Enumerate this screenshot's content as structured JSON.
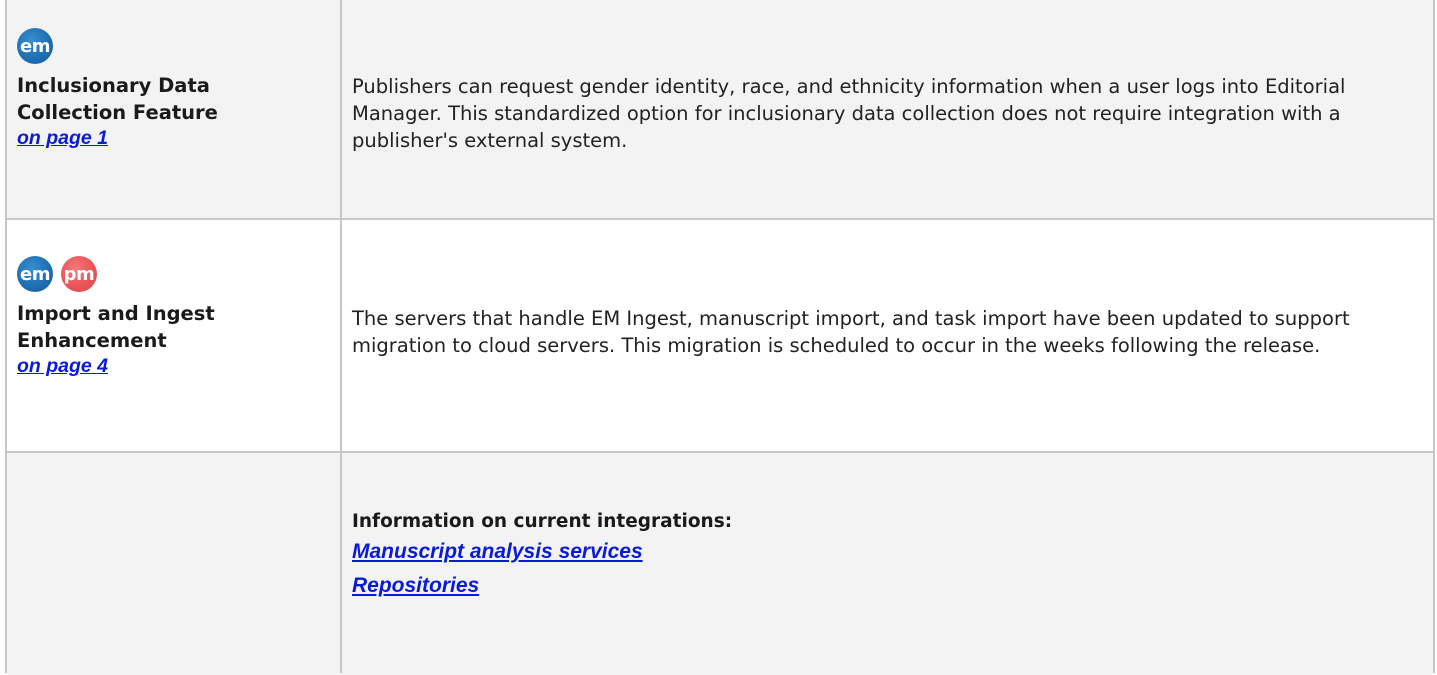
{
  "rows": [
    {
      "badges": [
        "em"
      ],
      "title": "Inclusionary Data Collection Feature",
      "link": "on page 1",
      "description": "Publishers can request gender identity, race, and ethnicity information when a user logs into Editorial Manager. This standardized option for inclusionary data collection does not require integration with a publisher's external system."
    },
    {
      "badges": [
        "em",
        "pm"
      ],
      "title": "Import and Ingest Enhancement",
      "link": "on page 4",
      "description": "The servers that handle EM Ingest, manuscript import, and task import have been updated to support migration to cloud servers. This migration is scheduled to occur in the weeks following the release."
    }
  ],
  "integrations": {
    "heading": "Information on current integrations:",
    "links": [
      "Manuscript analysis services",
      "Repositories"
    ]
  },
  "colors": {
    "em_badge": "#1f6fb3",
    "pm_badge": "#ea5557",
    "link": "#0a1bd6",
    "shaded_row": "#f3f3f3",
    "border": "#c7c7c7"
  },
  "icons": {
    "em": "em-badge-icon",
    "pm": "pm-badge-icon"
  }
}
